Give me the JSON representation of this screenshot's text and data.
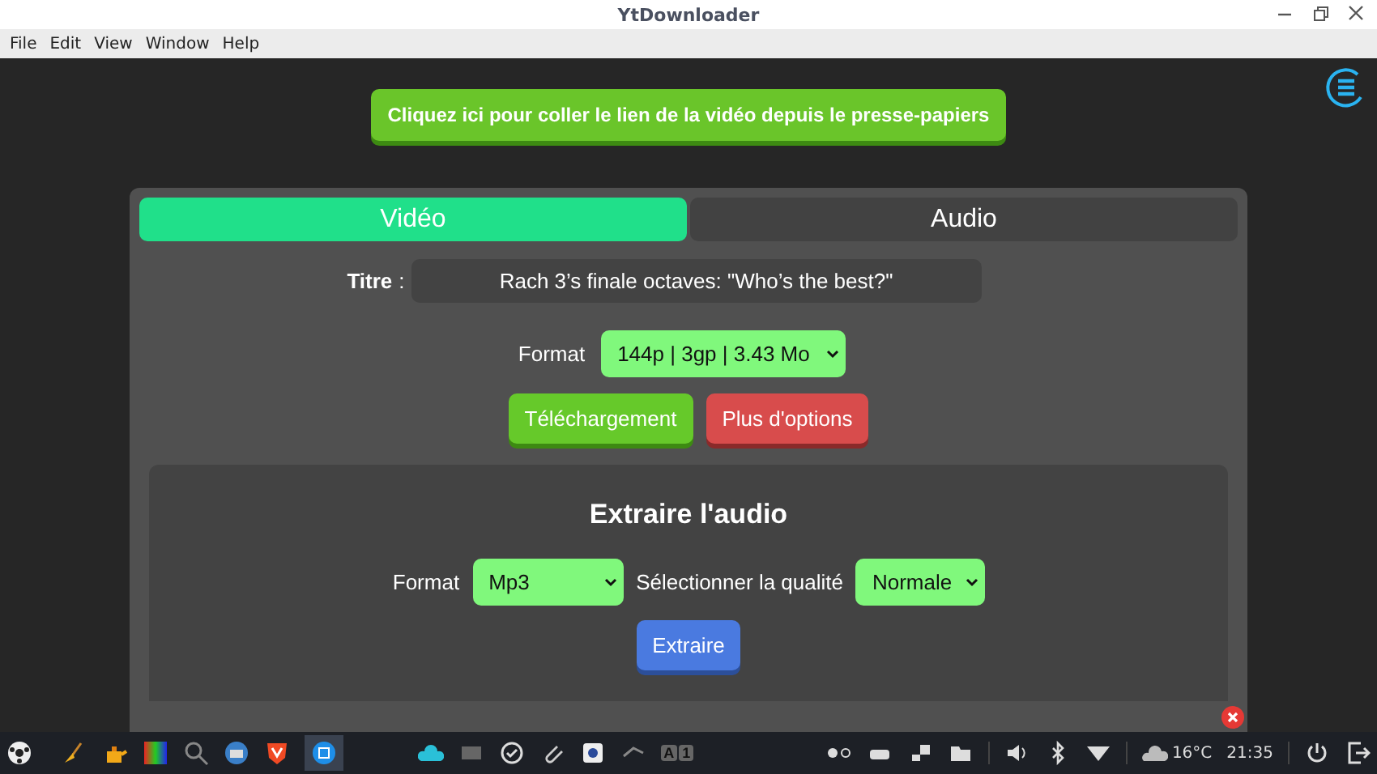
{
  "window": {
    "title": "YtDownloader"
  },
  "menu": [
    "File",
    "Edit",
    "View",
    "Window",
    "Help"
  ],
  "paste_button": "Cliquez ici pour coller le lien de la vidéo depuis le presse-papiers",
  "tabs": [
    {
      "label": "Vidéo",
      "selected": true
    },
    {
      "label": "Audio",
      "selected": false
    }
  ],
  "title_label": "Titre",
  "title_colon": ":",
  "title_value": "Rach 3’s finale octaves: \"Who’s the best?\"",
  "format_label": "Format",
  "format_value": "144p | 3gp | 3.43 Mo",
  "download_button": "Téléchargement",
  "options_button": "Plus d'options",
  "extract": {
    "heading": "Extraire l'audio",
    "format_label": "Format",
    "format_value": "Mp3",
    "quality_label": "Sélectionner la qualité",
    "quality_value": "Normale",
    "button": "Extraire"
  },
  "taskbar": {
    "keyboard": [
      "A",
      "1"
    ],
    "weather": "16°C",
    "clock": "21:35"
  }
}
